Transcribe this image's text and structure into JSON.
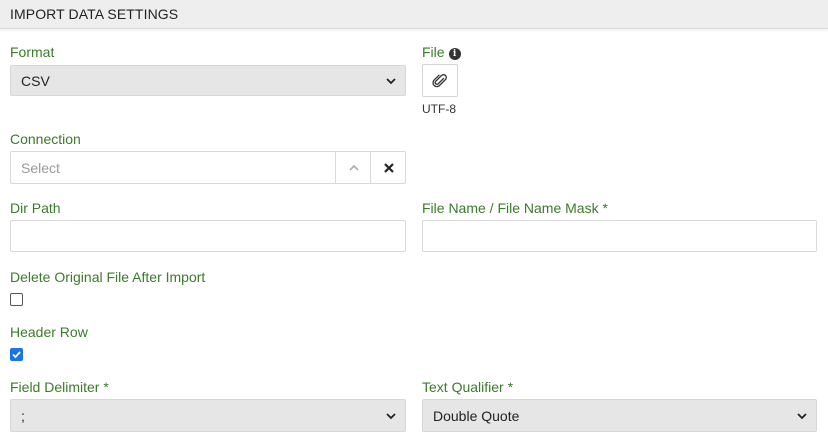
{
  "header": {
    "title": "IMPORT DATA SETTINGS"
  },
  "format": {
    "label": "Format",
    "value": "CSV"
  },
  "file": {
    "label": "File",
    "info_icon": "info-icon",
    "attach_icon": "paperclip-icon",
    "encoding": "UTF-8"
  },
  "connection": {
    "label": "Connection",
    "placeholder": "Select"
  },
  "dir_path": {
    "label": "Dir Path",
    "value": ""
  },
  "file_name": {
    "label": "File Name / File Name Mask *",
    "value": ""
  },
  "delete_original": {
    "label": "Delete Original File After Import",
    "checked": false
  },
  "header_row": {
    "label": "Header Row",
    "checked": true
  },
  "field_delimiter": {
    "label": "Field Delimiter *",
    "value": ";"
  },
  "text_qualifier": {
    "label": "Text Qualifier *",
    "value": "Double Quote"
  },
  "colors": {
    "label_green": "#3c7a2c",
    "checkbox_blue": "#1a73e8",
    "select_bg": "#e6e6e6"
  }
}
